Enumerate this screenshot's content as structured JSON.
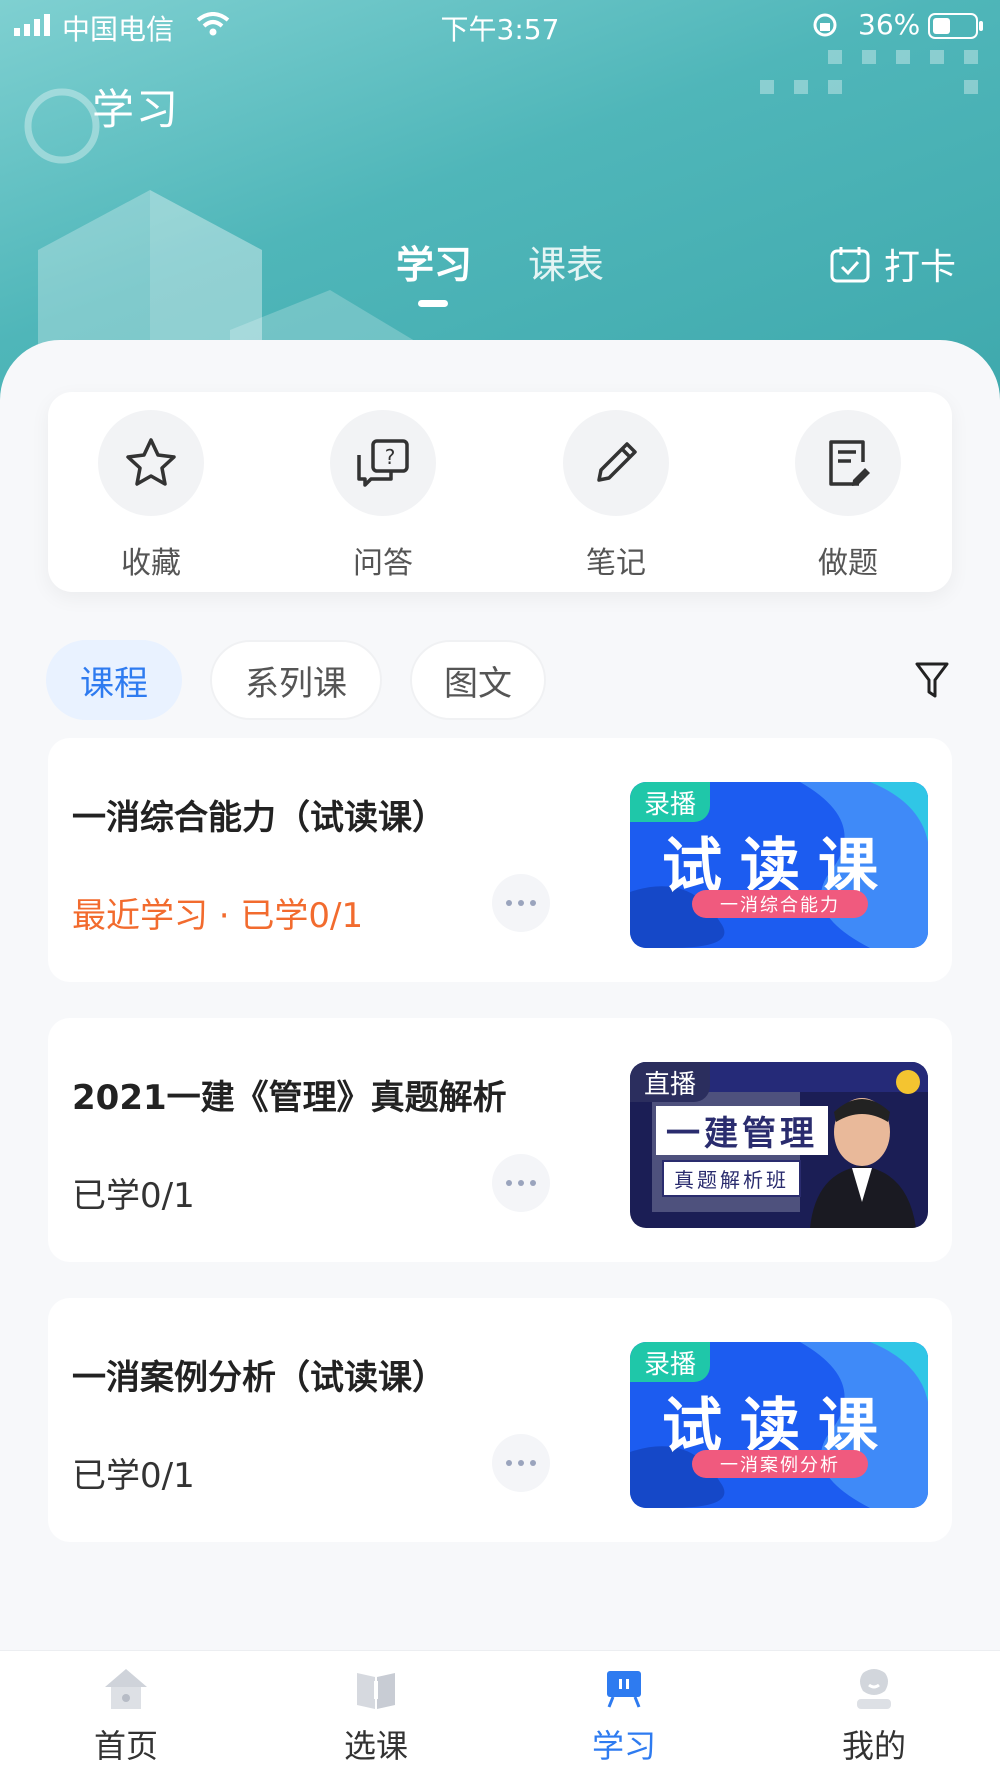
{
  "status_bar": {
    "carrier": "中国电信",
    "time": "下午3:57",
    "battery": "36%"
  },
  "header": {
    "title": "学习",
    "tabs": [
      {
        "label": "学习",
        "active": true
      },
      {
        "label": "课表",
        "active": false
      }
    ],
    "checkin_label": "打卡"
  },
  "tools": [
    {
      "label": "收藏",
      "icon": "star-icon"
    },
    {
      "label": "问答",
      "icon": "qa-icon"
    },
    {
      "label": "笔记",
      "icon": "pencil-icon"
    },
    {
      "label": "做题",
      "icon": "exercise-icon"
    }
  ],
  "filters": {
    "chips": [
      {
        "label": "课程",
        "active": true
      },
      {
        "label": "系列课",
        "active": false
      },
      {
        "label": "图文",
        "active": false
      }
    ],
    "filter_icon": "funnel-icon"
  },
  "courses": [
    {
      "title": "一消综合能力（试读课）",
      "meta": "最近学习 · 已学0/1",
      "meta_color": "#f26b2e",
      "thumb": {
        "badge": "录播",
        "headline": "试读课",
        "subtitle": "一消综合能力",
        "style": "blue"
      }
    },
    {
      "title": "2021一建《管理》真题解析",
      "meta": "已学0/1",
      "meta_color": "#333333",
      "thumb": {
        "badge": "直播",
        "headline": "一建管理",
        "subtitle": "真题解析班",
        "style": "dark"
      }
    },
    {
      "title": "一消案例分析（试读课）",
      "meta": "已学0/1",
      "meta_color": "#333333",
      "thumb": {
        "badge": "录播",
        "headline": "试读课",
        "subtitle": "一消案例分析",
        "style": "blue"
      }
    }
  ],
  "bottom_nav": [
    {
      "label": "首页",
      "icon": "home-icon",
      "active": false
    },
    {
      "label": "选课",
      "icon": "book-icon",
      "active": false
    },
    {
      "label": "学习",
      "icon": "study-icon",
      "active": true
    },
    {
      "label": "我的",
      "icon": "profile-icon",
      "active": false
    }
  ],
  "colors": {
    "accent": "#2e7bf0",
    "header_teal": "#4fb6b9",
    "highlight_orange": "#f26b2e"
  }
}
